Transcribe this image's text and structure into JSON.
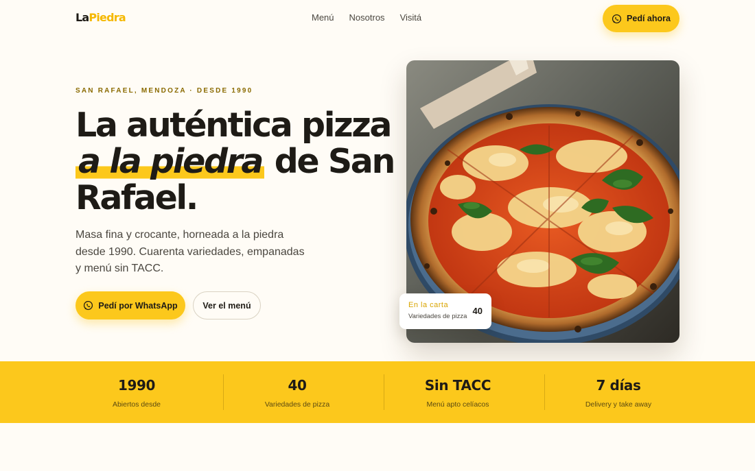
{
  "header": {
    "logo_part1": "La",
    "logo_part2": "Piedra",
    "nav": [
      {
        "label": "Menú"
      },
      {
        "label": "Nosotros"
      },
      {
        "label": "Visitá"
      }
    ],
    "cta_label": "Pedí ahora",
    "cta_icon": "whatsapp-icon"
  },
  "hero": {
    "eyebrow": "SAN RAFAEL, MENDOZA · DESDE 1990",
    "headline_line1": "La auténtica pizza",
    "headline_highlight": "a la piedra",
    "headline_after": " de San",
    "headline_line3": "Rafael.",
    "lede": "Masa fina y crocante, horneada a la piedra desde 1990. Cuarenta variedades, empanadas y menú sin TACC.",
    "primary_button": "Pedí por WhatsApp",
    "secondary_button": "Ver el menú",
    "image": "pizza-photo",
    "card": {
      "title": "En la carta",
      "subtitle": "Variedades de pizza",
      "value": "40"
    }
  },
  "stats": [
    {
      "value": "1990",
      "label": "Abiertos desde"
    },
    {
      "value": "40",
      "label": "Variedades de pizza"
    },
    {
      "value": "Sin TACC",
      "label": "Menú apto celíacos"
    },
    {
      "value": "7 días",
      "label": "Delivery y take away"
    }
  ],
  "colors": {
    "accent": "#fcc81c",
    "background": "#fffcf6",
    "text": "#1e1b16"
  }
}
